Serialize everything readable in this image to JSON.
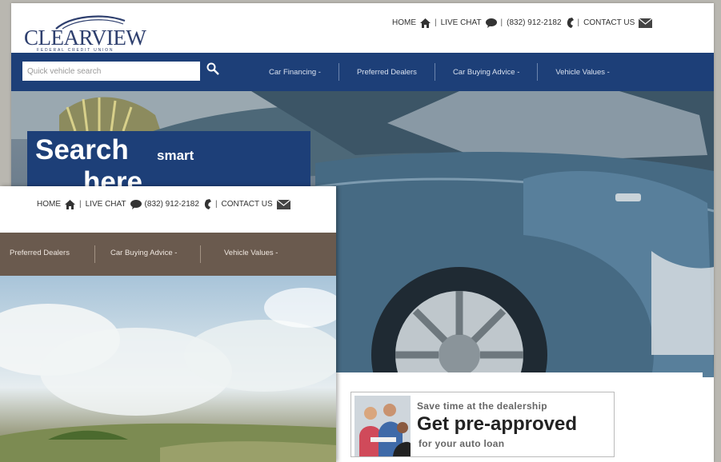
{
  "brand": {
    "name": "CLEARVIEW",
    "tagline": "FEDERAL CREDIT UNION"
  },
  "topnav": {
    "home": "HOME",
    "live_chat": "LIVE CHAT",
    "phone": "(832) 912-2182",
    "contact": "CONTACT US"
  },
  "search": {
    "placeholder": "Quick vehicle search"
  },
  "nav": {
    "items": [
      "Car Financing -",
      "Preferred Dealers",
      "Car Buying Advice -",
      "Vehicle Values -"
    ]
  },
  "hero": {
    "headline_big": "Search",
    "headline_small": "smart",
    "headline_line2": "here"
  },
  "promo": {
    "line1": "Save time at the dealership",
    "line2": "Get pre-approved",
    "line3": "for your auto loan"
  },
  "front": {
    "topnav": {
      "home": "HOME",
      "live_chat": "LIVE CHAT",
      "phone": "(832) 912-2182",
      "contact": "CONTACT US"
    },
    "nav": {
      "items": [
        "Preferred Dealers",
        "Car Buying Advice -",
        "Vehicle Values -"
      ]
    }
  },
  "colors": {
    "primary_blue": "#1d3f78",
    "front_nav_brown": "#6a5a4e"
  },
  "icons": [
    "home-icon",
    "chat-icon",
    "phone-icon",
    "mail-icon",
    "search-icon"
  ]
}
